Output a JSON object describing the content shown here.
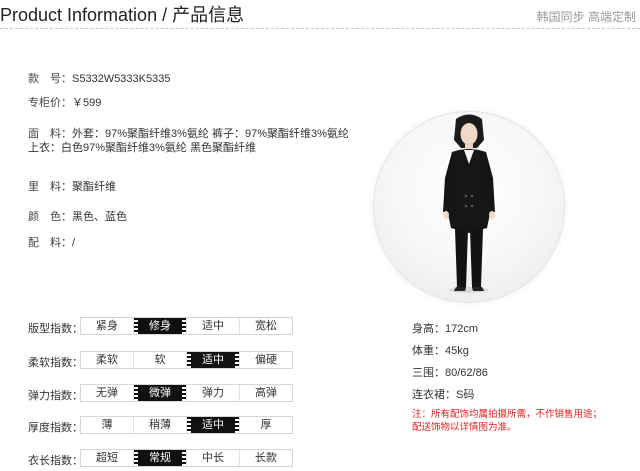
{
  "header": {
    "title": "Product Information / 产品信息",
    "subtitle": "韩国同步 高端定制"
  },
  "product": {
    "style_no": {
      "label": "款　号：",
      "value": "S5332W5333K5335"
    },
    "price": {
      "label": "专柜价：",
      "value": "￥599"
    },
    "fabric": {
      "label": "面　料：",
      "line1": "外套：97%聚酯纤维3%氨纶 裤子：97%聚酯纤维3%氨纶",
      "line2": "上衣：白色97%聚酯纤维3%氨纶 黑色聚酯纤维"
    },
    "lining": {
      "label": "里　料：",
      "value": "聚酯纤维"
    },
    "color": {
      "label": "颜　色：",
      "value": "黑色、蓝色"
    },
    "accessories": {
      "label": "配　料：",
      "value": "/"
    }
  },
  "indices": [
    {
      "label": "版型指数：",
      "options": [
        "紧身",
        "修身",
        "适中",
        "宽松"
      ],
      "selected": "修身"
    },
    {
      "label": "柔软指数：",
      "options": [
        "柔软",
        "软",
        "适中",
        "偏硬"
      ],
      "selected": "适中"
    },
    {
      "label": "弹力指数：",
      "options": [
        "无弹",
        "微弹",
        "弹力",
        "高弹"
      ],
      "selected": "微弹"
    },
    {
      "label": "厚度指数：",
      "options": [
        "薄",
        "稍薄",
        "适中",
        "厚"
      ],
      "selected": "适中"
    },
    {
      "label": "衣长指数：",
      "options": [
        "超短",
        "常规",
        "中长",
        "长款"
      ],
      "selected": "常规"
    }
  ],
  "model": {
    "height": "身高：172cm",
    "weight": "体重：45kg",
    "measurements": "三围：80/62/86",
    "size": "连衣裙：S码"
  },
  "note": {
    "line1": "注：所有配饰均属拍摄所需，不作销售用途；",
    "line2": "配送饰物以详情图为准。"
  },
  "colors": {
    "accent": "#111111",
    "note": "#e0201e",
    "subtitle": "#9a9a9a",
    "border": "#d6d6d6"
  },
  "image": {
    "icon": "model-photo"
  }
}
